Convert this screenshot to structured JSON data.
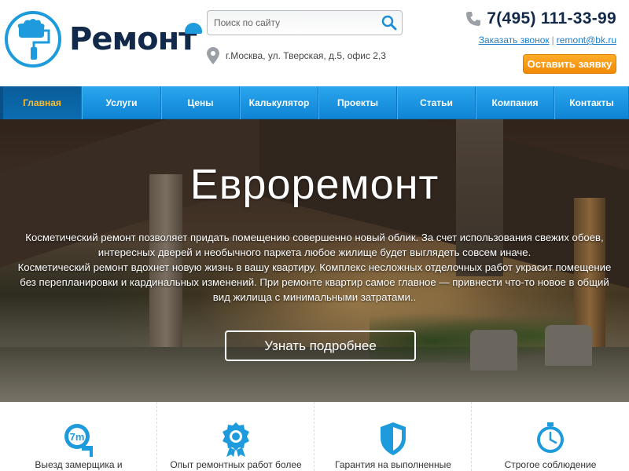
{
  "header": {
    "logo_text": "Ремонт",
    "search_placeholder": "Поиск по сайту",
    "address": "г.Москва, ул. Тверская, д.5, офис 2,3",
    "phone": "7(495) 111-33-99",
    "callback_link": "Заказать звонок",
    "email_link": "remont@bk.ru",
    "link_separator": "|",
    "cta_label": "Оставить заявку"
  },
  "nav": {
    "items": [
      {
        "label": "Главная",
        "active": true
      },
      {
        "label": "Услуги",
        "active": false
      },
      {
        "label": "Цены",
        "active": false
      },
      {
        "label": "Калькулятор",
        "active": false
      },
      {
        "label": "Проекты",
        "active": false
      },
      {
        "label": "Статьи",
        "active": false
      },
      {
        "label": "Компания",
        "active": false
      },
      {
        "label": "Контакты",
        "active": false
      }
    ]
  },
  "hero": {
    "title": "Евроремонт",
    "paragraph_lines": [
      "Косметический ремонт позволяет придать помещению совершенно новый облик. За счет использования свежих обоев,",
      "интересных дверей и необычного паркета любое жилище будет выглядеть совсем иначе.",
      "Косметический ремонт вдохнет новую жизнь в вашу квартиру. Комплекс несложных отделочных работ украсит помещение",
      "без перепланировки и кардинальных изменений. При ремонте квартир самое главное — привнести что-то новое в общий",
      "вид жилища с минимальными затратами.."
    ],
    "button_label": "Узнать подробнее"
  },
  "features": [
    {
      "icon": "tape-measure-icon",
      "text": "Выезд замерщика и",
      "icon_label": "7m"
    },
    {
      "icon": "award-badge-icon",
      "text": "Опыт ремонтных работ более"
    },
    {
      "icon": "shield-icon",
      "text": "Гарантия на выполненные"
    },
    {
      "icon": "clock-icon",
      "text": "Строгое соблюдение"
    }
  ],
  "colors": {
    "brand_blue": "#1e9bdc",
    "nav_active_text": "#ffbd2e",
    "cta_orange": "#f59a14",
    "logo_dark": "#12294a"
  }
}
